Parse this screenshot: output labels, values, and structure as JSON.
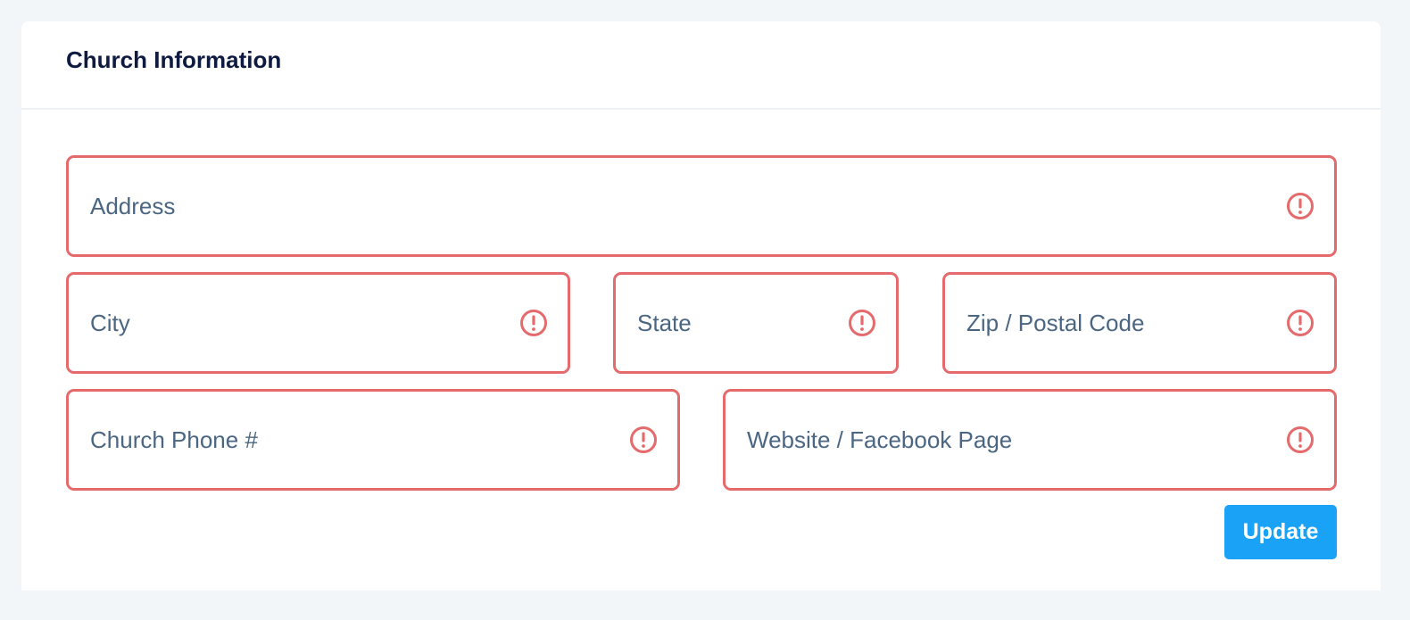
{
  "card": {
    "title": "Church Information"
  },
  "fields": {
    "address": {
      "placeholder": "Address",
      "value": ""
    },
    "city": {
      "placeholder": "City",
      "value": ""
    },
    "state": {
      "placeholder": "State",
      "value": ""
    },
    "zip": {
      "placeholder": "Zip / Postal Code",
      "value": ""
    },
    "phone": {
      "placeholder": "Church Phone #",
      "value": ""
    },
    "website": {
      "placeholder": "Website / Facebook Page",
      "value": ""
    }
  },
  "icons": {
    "field_error": "alert-circle-icon"
  },
  "colors": {
    "error_border": "#e56a6c",
    "button_bg": "#1aa3f6",
    "title": "#0f1a40"
  },
  "actions": {
    "update_label": "Update"
  }
}
